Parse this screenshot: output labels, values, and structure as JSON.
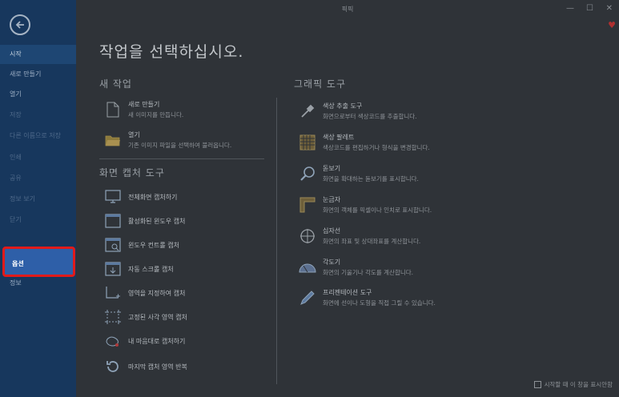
{
  "window": {
    "title": "픽픽",
    "minimize": "—",
    "maximize": "☐",
    "close": "✕"
  },
  "sidebar": {
    "items": [
      {
        "label": "시작"
      },
      {
        "label": "새로 만들기"
      },
      {
        "label": "열기"
      },
      {
        "label": "저장"
      },
      {
        "label": "다른 이름으로 저장"
      },
      {
        "label": "인쇄"
      },
      {
        "label": "공유"
      },
      {
        "label": "정보 보기"
      },
      {
        "label": "닫기"
      },
      {
        "label": "옵션"
      },
      {
        "label": "정보"
      }
    ]
  },
  "main": {
    "title": "작업을 선택하십시오.",
    "new_task": {
      "heading": "새 작업",
      "items": [
        {
          "title": "새로 만들기",
          "desc": "새 이미지를 만듭니다."
        },
        {
          "title": "열기",
          "desc": "기존 이미지 파일을 선택하여 불러옵니다."
        }
      ]
    },
    "capture": {
      "heading": "화면 캡처 도구",
      "items": [
        {
          "title": "전체화면 캡처하기"
        },
        {
          "title": "활성화된 윈도우 캡처"
        },
        {
          "title": "윈도우 컨트롤 캡처"
        },
        {
          "title": "자동 스크롤 캡처"
        },
        {
          "title": "영역을 지정하여 캡처"
        },
        {
          "title": "고정된 사각 영역 캡처"
        },
        {
          "title": "내 마음대로 캡처하기"
        },
        {
          "title": "마지막 캡처 영역 반복"
        }
      ]
    },
    "graphic": {
      "heading": "그래픽 도구",
      "items": [
        {
          "title": "색상 추출 도구",
          "desc": "화면으로부터 색상코드를 추출합니다."
        },
        {
          "title": "색상 팔레트",
          "desc": "색상코드를 편집하거나 형식을 변경합니다."
        },
        {
          "title": "돋보기",
          "desc": "화면을 확대하는 돋보기를 표시합니다."
        },
        {
          "title": "눈금자",
          "desc": "화면의 객체를 픽셀이나 인치로 표시합니다."
        },
        {
          "title": "십자선",
          "desc": "화면의 좌표 및 상대좌표를 계산합니다."
        },
        {
          "title": "각도기",
          "desc": "화면의 기울기나 각도를 계산합니다."
        },
        {
          "title": "프리젠테이션 도구",
          "desc": "화면에 선이나 도형을 직접 그릴 수 있습니다."
        }
      ]
    }
  },
  "footer": {
    "checkbox_label": "시작할 때 이 창을 표시안함"
  }
}
